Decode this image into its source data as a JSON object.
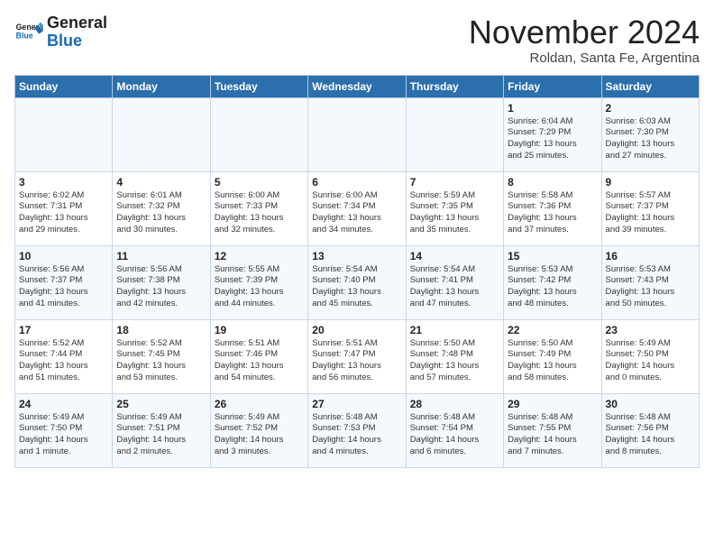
{
  "logo": {
    "line1": "General",
    "line2": "Blue"
  },
  "title": "November 2024",
  "subtitle": "Roldan, Santa Fe, Argentina",
  "header": {
    "days": [
      "Sunday",
      "Monday",
      "Tuesday",
      "Wednesday",
      "Thursday",
      "Friday",
      "Saturday"
    ]
  },
  "weeks": [
    [
      {
        "day": "",
        "info": ""
      },
      {
        "day": "",
        "info": ""
      },
      {
        "day": "",
        "info": ""
      },
      {
        "day": "",
        "info": ""
      },
      {
        "day": "",
        "info": ""
      },
      {
        "day": "1",
        "info": "Sunrise: 6:04 AM\nSunset: 7:29 PM\nDaylight: 13 hours\nand 25 minutes."
      },
      {
        "day": "2",
        "info": "Sunrise: 6:03 AM\nSunset: 7:30 PM\nDaylight: 13 hours\nand 27 minutes."
      }
    ],
    [
      {
        "day": "3",
        "info": "Sunrise: 6:02 AM\nSunset: 7:31 PM\nDaylight: 13 hours\nand 29 minutes."
      },
      {
        "day": "4",
        "info": "Sunrise: 6:01 AM\nSunset: 7:32 PM\nDaylight: 13 hours\nand 30 minutes."
      },
      {
        "day": "5",
        "info": "Sunrise: 6:00 AM\nSunset: 7:33 PM\nDaylight: 13 hours\nand 32 minutes."
      },
      {
        "day": "6",
        "info": "Sunrise: 6:00 AM\nSunset: 7:34 PM\nDaylight: 13 hours\nand 34 minutes."
      },
      {
        "day": "7",
        "info": "Sunrise: 5:59 AM\nSunset: 7:35 PM\nDaylight: 13 hours\nand 35 minutes."
      },
      {
        "day": "8",
        "info": "Sunrise: 5:58 AM\nSunset: 7:36 PM\nDaylight: 13 hours\nand 37 minutes."
      },
      {
        "day": "9",
        "info": "Sunrise: 5:57 AM\nSunset: 7:37 PM\nDaylight: 13 hours\nand 39 minutes."
      }
    ],
    [
      {
        "day": "10",
        "info": "Sunrise: 5:56 AM\nSunset: 7:37 PM\nDaylight: 13 hours\nand 41 minutes."
      },
      {
        "day": "11",
        "info": "Sunrise: 5:56 AM\nSunset: 7:38 PM\nDaylight: 13 hours\nand 42 minutes."
      },
      {
        "day": "12",
        "info": "Sunrise: 5:55 AM\nSunset: 7:39 PM\nDaylight: 13 hours\nand 44 minutes."
      },
      {
        "day": "13",
        "info": "Sunrise: 5:54 AM\nSunset: 7:40 PM\nDaylight: 13 hours\nand 45 minutes."
      },
      {
        "day": "14",
        "info": "Sunrise: 5:54 AM\nSunset: 7:41 PM\nDaylight: 13 hours\nand 47 minutes."
      },
      {
        "day": "15",
        "info": "Sunrise: 5:53 AM\nSunset: 7:42 PM\nDaylight: 13 hours\nand 48 minutes."
      },
      {
        "day": "16",
        "info": "Sunrise: 5:53 AM\nSunset: 7:43 PM\nDaylight: 13 hours\nand 50 minutes."
      }
    ],
    [
      {
        "day": "17",
        "info": "Sunrise: 5:52 AM\nSunset: 7:44 PM\nDaylight: 13 hours\nand 51 minutes."
      },
      {
        "day": "18",
        "info": "Sunrise: 5:52 AM\nSunset: 7:45 PM\nDaylight: 13 hours\nand 53 minutes."
      },
      {
        "day": "19",
        "info": "Sunrise: 5:51 AM\nSunset: 7:46 PM\nDaylight: 13 hours\nand 54 minutes."
      },
      {
        "day": "20",
        "info": "Sunrise: 5:51 AM\nSunset: 7:47 PM\nDaylight: 13 hours\nand 56 minutes."
      },
      {
        "day": "21",
        "info": "Sunrise: 5:50 AM\nSunset: 7:48 PM\nDaylight: 13 hours\nand 57 minutes."
      },
      {
        "day": "22",
        "info": "Sunrise: 5:50 AM\nSunset: 7:49 PM\nDaylight: 13 hours\nand 58 minutes."
      },
      {
        "day": "23",
        "info": "Sunrise: 5:49 AM\nSunset: 7:50 PM\nDaylight: 14 hours\nand 0 minutes."
      }
    ],
    [
      {
        "day": "24",
        "info": "Sunrise: 5:49 AM\nSunset: 7:50 PM\nDaylight: 14 hours\nand 1 minute."
      },
      {
        "day": "25",
        "info": "Sunrise: 5:49 AM\nSunset: 7:51 PM\nDaylight: 14 hours\nand 2 minutes."
      },
      {
        "day": "26",
        "info": "Sunrise: 5:49 AM\nSunset: 7:52 PM\nDaylight: 14 hours\nand 3 minutes."
      },
      {
        "day": "27",
        "info": "Sunrise: 5:48 AM\nSunset: 7:53 PM\nDaylight: 14 hours\nand 4 minutes."
      },
      {
        "day": "28",
        "info": "Sunrise: 5:48 AM\nSunset: 7:54 PM\nDaylight: 14 hours\nand 6 minutes."
      },
      {
        "day": "29",
        "info": "Sunrise: 5:48 AM\nSunset: 7:55 PM\nDaylight: 14 hours\nand 7 minutes."
      },
      {
        "day": "30",
        "info": "Sunrise: 5:48 AM\nSunset: 7:56 PM\nDaylight: 14 hours\nand 8 minutes."
      }
    ]
  ]
}
